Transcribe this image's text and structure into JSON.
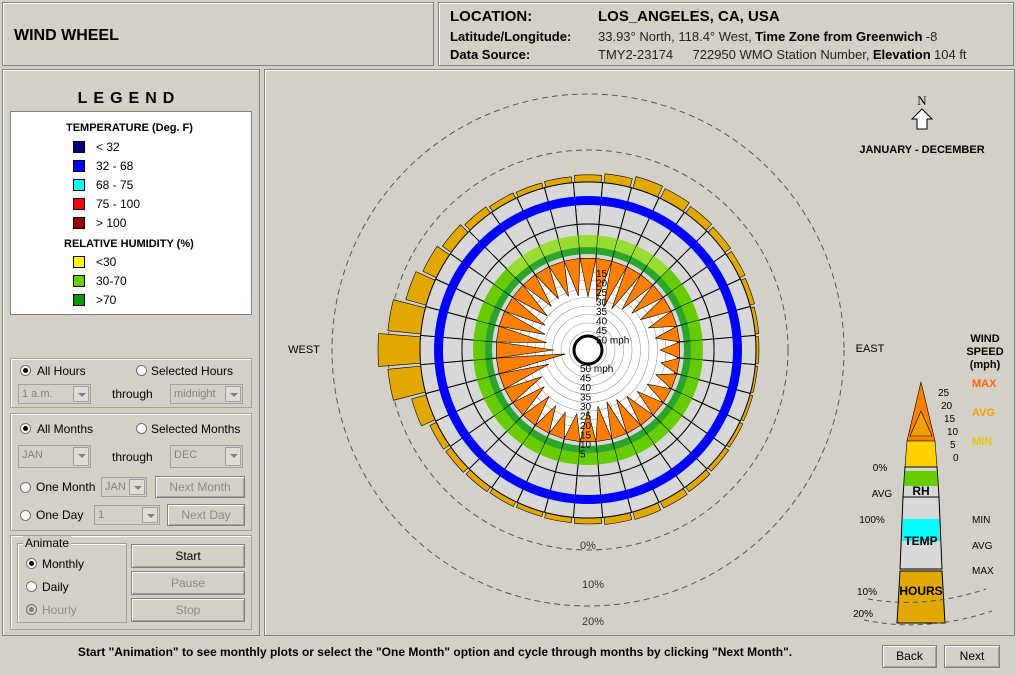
{
  "app_title": "WIND WHEEL",
  "header": {
    "location_label": "LOCATION:",
    "location_value": "LOS_ANGELES, CA, USA",
    "latlon_label": "Latitude/Longitude:",
    "latlon_value": "33.93° North, 118.4° West,",
    "tz_label": "Time Zone from Greenwich",
    "tz_value": "-8",
    "source_label": "Data Source:",
    "source_value": "TMY2-23174",
    "station_value": "722950 WMO Station Number,",
    "elev_label": "Elevation",
    "elev_value": "104 ft"
  },
  "legend": {
    "title": "LEGEND",
    "temp_heading": "TEMPERATURE (Deg. F)",
    "temp_items": [
      {
        "label": "< 32",
        "color": "#000080"
      },
      {
        "label": "32  -  68",
        "color": "#0000ff"
      },
      {
        "label": "68  -  75",
        "color": "#00ffff"
      },
      {
        "label": "75  -  100",
        "color": "#ff0000"
      },
      {
        "label": "> 100",
        "color": "#990000"
      }
    ],
    "rh_heading": "RELATIVE HUMIDITY (%)",
    "rh_items": [
      {
        "label": "<30",
        "color": "#ffff00"
      },
      {
        "label": "30-70",
        "color": "#66cc00"
      },
      {
        "label": ">70",
        "color": "#009900"
      }
    ]
  },
  "hours": {
    "all_label": "All Hours",
    "selected_label": "Selected Hours",
    "from": "1 a.m.",
    "through": "through",
    "to": "midnight"
  },
  "months": {
    "all_label": "All Months",
    "selected_label": "Selected Months",
    "from": "JAN",
    "through": "through",
    "to": "DEC",
    "one_month_label": "One Month",
    "one_month_value": "JAN",
    "next_month": "Next Month",
    "one_day_label": "One Day",
    "one_day_value": "1",
    "next_day": "Next Day"
  },
  "animate": {
    "group_label": "Animate",
    "monthly": "Monthly",
    "daily": "Daily",
    "hourly": "Hourly",
    "start": "Start",
    "pause": "Pause",
    "stop": "Stop"
  },
  "plot": {
    "north_label": "N",
    "period": "JANUARY - DECEMBER",
    "west": "WEST",
    "east": "EAST",
    "pct_labels": [
      "0%",
      "10%",
      "20%"
    ],
    "speed_ticks": [
      "15",
      "20",
      "25",
      "30",
      "35",
      "40",
      "45",
      "50 mph"
    ],
    "speed_ticks_lower": [
      "50 mph",
      "45",
      "40",
      "35",
      "30",
      "25",
      "20",
      "15",
      "10",
      "5"
    ]
  },
  "key": {
    "title_lines": [
      "WIND",
      "SPEED",
      "(mph)"
    ],
    "max": "MAX",
    "avg": "AVG",
    "min": "MIN",
    "ticks": [
      "25",
      "20",
      "15",
      "10",
      "5",
      "0"
    ],
    "rh_label": "RH",
    "temp_label": "TEMP",
    "hours_label": "HOURS",
    "rh_left": [
      "0%",
      "AVG",
      "100%"
    ],
    "temp_right": [
      "MIN",
      "AVG",
      "MAX"
    ],
    "hours_left": [
      "10%",
      "20%"
    ],
    "colors": {
      "max": "#ff6600",
      "avg": "#f0a000",
      "min": "#e8c800"
    }
  },
  "footer": {
    "message": "Start \"Animation\" to see monthly plots or select the \"One Month\" option and cycle through months by clicking \"Next Month\".",
    "back": "Back",
    "next": "Next"
  },
  "chart_data": {
    "type": "wind-rose",
    "directions": 36,
    "hours_pct": [
      1.2,
      1.5,
      2.0,
      1.8,
      1.4,
      1.2,
      1.0,
      0.8,
      0.6,
      0.5,
      0.4,
      0.5,
      0.6,
      0.8,
      1.0,
      1.2,
      1.3,
      1.2,
      1.0,
      0.9,
      0.8,
      0.9,
      1.0,
      1.1,
      1.2,
      2.5,
      5.5,
      7.0,
      5.5,
      3.5,
      2.5,
      1.8,
      1.3,
      1.0,
      0.9,
      1.0
    ],
    "speed_max": [
      22,
      24,
      26,
      25,
      22,
      20,
      18,
      16,
      14,
      12,
      11,
      12,
      14,
      16,
      18,
      20,
      21,
      20,
      18,
      16,
      15,
      16,
      18,
      20,
      22,
      28,
      38,
      32,
      28,
      26,
      24,
      22,
      20,
      19,
      20,
      21
    ],
    "ring_colors": {
      "outer": "#d8d8d8",
      "temp": "#0000ff",
      "rh": "#66cc00",
      "rh_light": "#99dd33",
      "rh_dark": "#009900",
      "hours": "#e0a800"
    }
  }
}
